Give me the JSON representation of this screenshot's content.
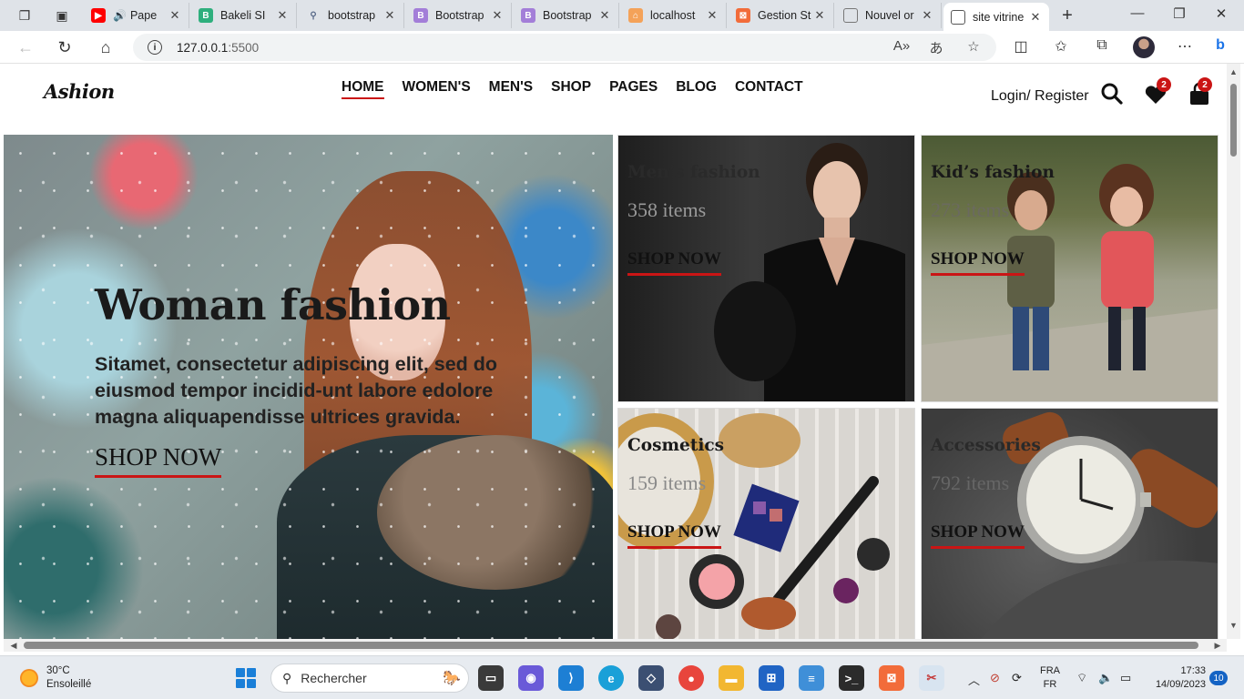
{
  "browser": {
    "tabs": [
      {
        "label": "Pape",
        "icon": "youtube-icon",
        "color": "#ff0000"
      },
      {
        "label": "Bakeli SI",
        "icon": "bakeli-icon",
        "color": "#2eaf7d"
      },
      {
        "label": "bootstrap",
        "icon": "search-icon",
        "color": "#5a6b8a"
      },
      {
        "label": "Bootstrap",
        "icon": "bootstrap-icon",
        "color": "#a37ed8"
      },
      {
        "label": "Bootstrap",
        "icon": "bootstrap-icon",
        "color": "#a37ed8"
      },
      {
        "label": "localhost",
        "icon": "xampp-icon",
        "color": "#f4a259"
      },
      {
        "label": "Gestion St",
        "icon": "xampp-icon",
        "color": "#f26c3a"
      },
      {
        "label": "Nouvel or",
        "icon": "page-icon",
        "color": "#777777"
      },
      {
        "label": "site vitrine",
        "icon": "page-icon",
        "color": "#555555"
      }
    ],
    "url_host": "127.0.0.1",
    "url_port": ":5500"
  },
  "site": {
    "logo": "Ashion",
    "nav": [
      "HOME",
      "WOMEN'S",
      "MEN'S",
      "SHOP",
      "PAGES",
      "BLOG",
      "CONTACT"
    ],
    "login": "Login/ Register",
    "wishlist_count": "2",
    "cart_count": "2",
    "accent": "#ca1515"
  },
  "hero": {
    "title": "Woman fashion",
    "text": "Sitamet, consectetur adipiscing elit, sed do eiusmod tempor incidid-unt labore edolore magna aliquapendisse ultrices gravida.",
    "cta": "SHOP NOW"
  },
  "categories": [
    {
      "title": "Men’s fashion",
      "count": "358 items",
      "cta": "SHOP NOW"
    },
    {
      "title": "Kid’s fashion",
      "count": "273 items",
      "cta": "SHOP NOW"
    },
    {
      "title": "Cosmetics",
      "count": "159 items",
      "cta": "SHOP NOW"
    },
    {
      "title": "Accessories",
      "count": "792 items",
      "cta": "SHOP NOW"
    }
  ],
  "taskbar": {
    "weather_temp": "30°C",
    "weather_desc": "Ensoleillé",
    "search_placeholder": "Rechercher",
    "lang_top": "FRA",
    "lang_bottom": "FR",
    "time": "17:33",
    "date": "14/09/2023",
    "notifications": "10"
  }
}
